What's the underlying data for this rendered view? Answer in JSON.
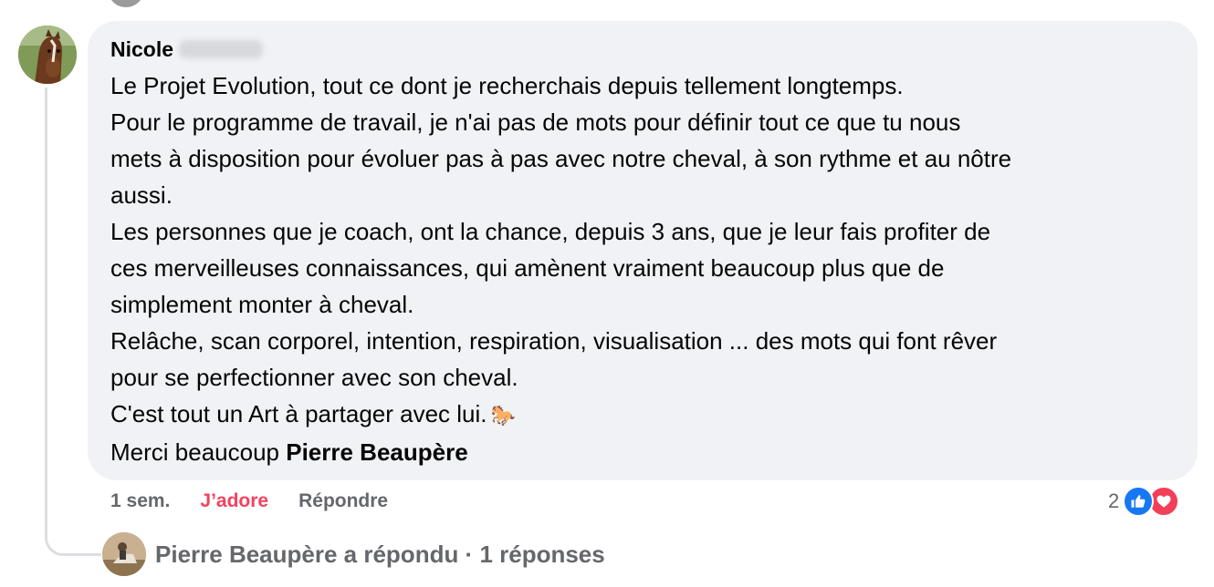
{
  "comment": {
    "author_name": "Nicole",
    "lines": [
      "Le Projet Evolution, tout ce dont je recherchais depuis tellement longtemps.",
      "Pour le programme de travail, je n'ai pas de mots pour définir tout ce que tu nous",
      "mets à disposition pour évoluer pas à pas avec notre cheval, à son rythme et au nôtre",
      "aussi.",
      "Les personnes que je coach, ont la chance, depuis 3 ans, que je leur fais profiter de",
      "ces merveilleuses connaissances, qui amènent vraiment beaucoup plus que de",
      "simplement monter à cheval.",
      "Relâche, scan corporel, intention, respiration, visualisation ... des mots qui font rêver",
      "pour se perfectionner avec son cheval."
    ],
    "art_line": "C'est tout un Art à partager avec lui.",
    "emoji": "🐎",
    "thanks_prefix": "Merci beaucoup ",
    "mention": "Pierre Beaupère"
  },
  "actions": {
    "time": "1 sem.",
    "love": "J’adore",
    "reply": "Répondre"
  },
  "reactions": {
    "count": "2",
    "icons": [
      "like-icon",
      "heart-icon"
    ],
    "colors": {
      "like": "#1877f2",
      "love": "#f33e58"
    }
  },
  "reply_summary": {
    "text": "Pierre Beaupère a répondu · 1 réponses"
  },
  "colors": {
    "bubble_bg": "#f0f2f5",
    "secondary_text": "#65676b",
    "love_active": "#f3425f"
  }
}
